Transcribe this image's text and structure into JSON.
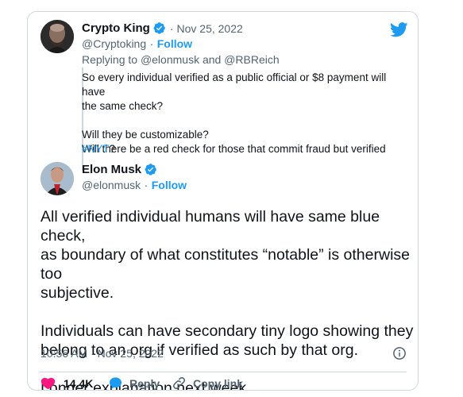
{
  "quoted_tweet": {
    "display_name": "Crypto King",
    "date": "Nov 25, 2022",
    "handle": "@Cryptoking",
    "follow": "Follow",
    "replying_prefix": "Replying to",
    "reply_user_1": "@elonmusk",
    "reply_and": "and",
    "reply_user_2": "@RBReich",
    "text": "So every individual verified as a public official or $8 payment will have\nthe same check?\n\nWill they be customizable?\nWill there be a red check for those that commit fraud but verified",
    "hashtag": "#NYT",
    "hashtag_suffix": "?"
  },
  "main_tweet": {
    "display_name": "Elon Musk",
    "handle": "@elonmusk",
    "follow": "Follow",
    "text": "All verified individual humans will have same blue check,\nas boundary of what constitutes “notable” is otherwise too\nsubjective.\n\nIndividuals can have secondary tiny logo showing they\nbelong to an org if verified as such by that org.\n\nLonger explanation next week.",
    "timestamp": "10:56 AM · Nov 25, 2022"
  },
  "actions": {
    "like_count": "14.4K",
    "reply_label": "Reply",
    "copy_link_label": "Copy link"
  },
  "separators": {
    "dot": "·"
  },
  "colors": {
    "accent": "#1d9bf0",
    "like": "#f91880",
    "text": "#0f1419",
    "muted": "#536471"
  },
  "icons": [
    "twitter-bird-icon",
    "verified-badge-icon",
    "info-icon",
    "heart-icon",
    "reply-bubble-icon",
    "link-icon"
  ]
}
